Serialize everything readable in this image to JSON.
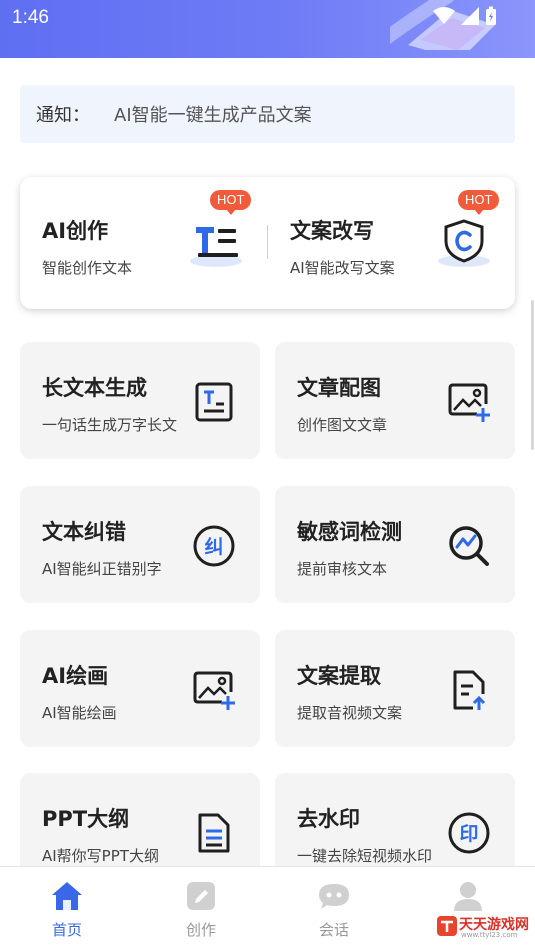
{
  "status_bar": {
    "time": "1:46",
    "icons": [
      "wifi-icon",
      "signal-icon",
      "battery-icon"
    ]
  },
  "notice": {
    "label": "通知：",
    "text": "AI智能一键生成产品文案"
  },
  "featured": [
    {
      "title": "AI创作",
      "subtitle": "智能创作文本",
      "badge": "HOT",
      "icon": "text-create-icon"
    },
    {
      "title": "文案改写",
      "subtitle": "AI智能改写文案",
      "badge": "HOT",
      "icon": "shield-c-icon"
    }
  ],
  "tools": [
    {
      "title": "长文本生成",
      "subtitle": "一句话生成万字长文",
      "icon": "document-text-icon"
    },
    {
      "title": "文章配图",
      "subtitle": "创作图文文章",
      "icon": "image-add-icon"
    },
    {
      "title": "文本纠错",
      "subtitle": "AI智能纠正错别字",
      "icon": "correct-circle-icon",
      "glyph": "纠"
    },
    {
      "title": "敏感词检测",
      "subtitle": "提前审核文本",
      "icon": "search-chart-icon"
    },
    {
      "title": "AI绘画",
      "subtitle": "AI智能绘画",
      "icon": "image-add-icon"
    },
    {
      "title": "文案提取",
      "subtitle": "提取音视频文案",
      "icon": "file-upload-icon"
    },
    {
      "title": "PPT大纲",
      "subtitle": "AI帮你写PPT大纲",
      "icon": "file-lines-icon"
    },
    {
      "title": "去水印",
      "subtitle": "一键去除短视频水印",
      "icon": "stamp-circle-icon",
      "glyph": "印"
    }
  ],
  "bottom_nav": [
    {
      "label": "首页",
      "icon": "home-icon",
      "active": true
    },
    {
      "label": "创作",
      "icon": "pencil-icon",
      "active": false
    },
    {
      "label": "会话",
      "icon": "chat-icon",
      "active": false
    },
    {
      "label": "",
      "icon": "user-icon",
      "active": false
    }
  ],
  "watermark": {
    "text": "天天游戏网",
    "url": "www.ttyl23.com"
  },
  "colors": {
    "accent": "#3a67e8",
    "hot": "#f25a3b",
    "header": "#6f7cf6",
    "card": "#f4f4f4"
  }
}
